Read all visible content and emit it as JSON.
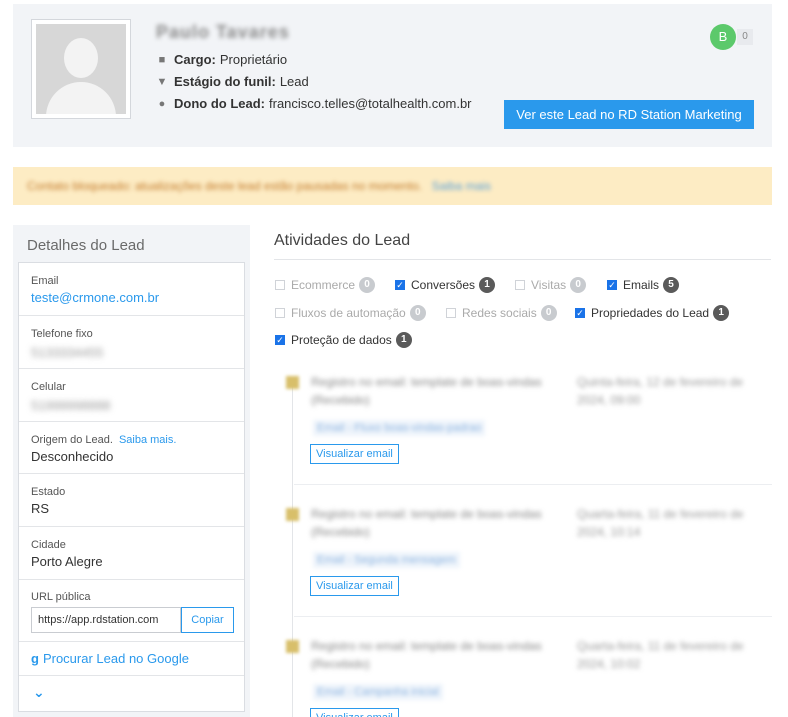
{
  "header": {
    "lead_name": "Paulo Tavares",
    "cargo_label": "Cargo:",
    "cargo_value": "Proprietário",
    "funil_label": "Estágio do funil:",
    "funil_value": "Lead",
    "dono_label": "Dono do Lead:",
    "dono_value": "francisco.telles@totalhealth.com.br",
    "badge_letter": "B",
    "badge_count": "0",
    "rd_button_label": "Ver este Lead no RD Station Marketing"
  },
  "alert": {
    "text": "Contato bloqueado: atualizações deste lead estão pausadas no momento.",
    "link": "Saiba mais"
  },
  "details": {
    "title": "Detalhes do Lead",
    "email_label": "Email",
    "email_value": "teste@crmone.com.br",
    "telefone_label": "Telefone fixo",
    "telefone_value": "5133334455",
    "celular_label": "Celular",
    "celular_value": "51999998888",
    "origem_label": "Origem do Lead.",
    "origem_link": "Saiba mais.",
    "origem_value": "Desconhecido",
    "estado_label": "Estado",
    "estado_value": "RS",
    "cidade_label": "Cidade",
    "cidade_value": "Porto Alegre",
    "url_label": "URL pública",
    "url_value": "https://app.rdstation.com",
    "copy_label": "Copiar",
    "google_label": "Procurar Lead no Google"
  },
  "activities": {
    "title": "Atividades do Lead",
    "filters": [
      {
        "label": "Ecommerce",
        "count": "0"
      },
      {
        "label": "Conversões",
        "count": "1"
      },
      {
        "label": "Visitas",
        "count": "0"
      },
      {
        "label": "Emails",
        "count": "5"
      },
      {
        "label": "Fluxos de automação",
        "count": "0"
      },
      {
        "label": "Redes sociais",
        "count": "0"
      },
      {
        "label": "Propriedades do Lead",
        "count": "1"
      },
      {
        "label": "Proteção de dados",
        "count": "1"
      }
    ],
    "items": [
      {
        "text": "Registro no email: template de boas-vindas (Recebido)",
        "date": "Quinta-feira, 12 de fevereiro de 2024, 09:00",
        "link": "Email - Fluxo boas-vindas-padrao",
        "view_label": "Visualizar email"
      },
      {
        "text": "Registro no email: template de boas-vindas (Recebido)",
        "date": "Quarta-feira, 11 de fevereiro de 2024, 10:14",
        "link": "Email - Segunda mensagem",
        "view_label": "Visualizar email"
      },
      {
        "text": "Registro no email: template de boas-vindas (Recebido)",
        "date": "Quarta-feira, 11 de fevereiro de 2024, 10:02",
        "link": "Email - Campanha inicial",
        "view_label": "Visualizar email"
      }
    ]
  }
}
